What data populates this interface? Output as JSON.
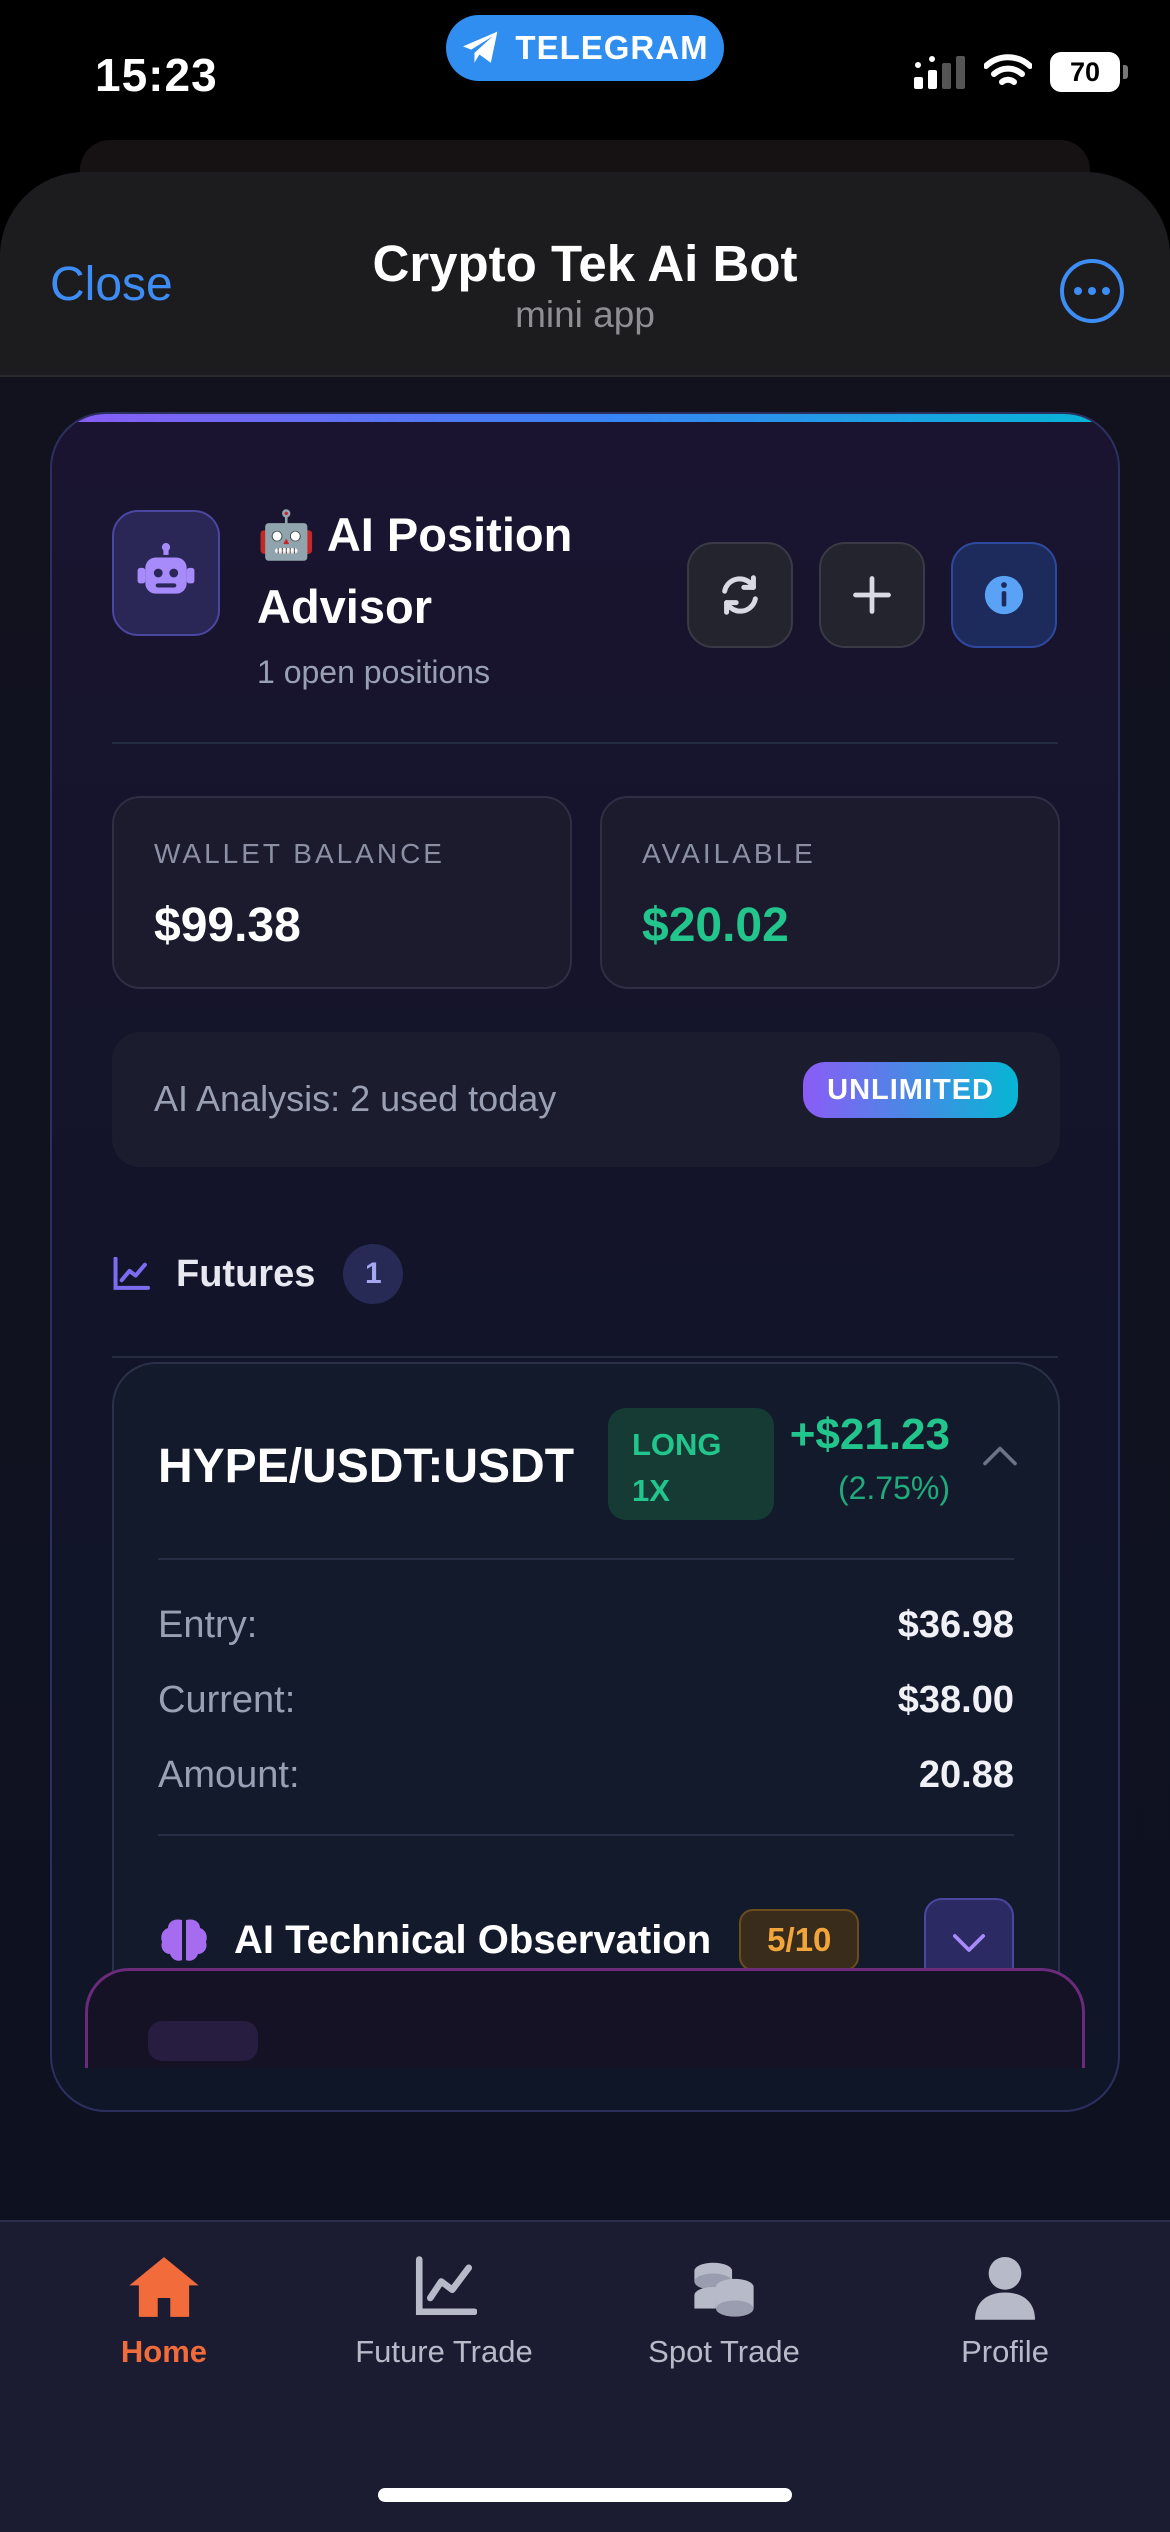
{
  "status_bar": {
    "time": "15:23",
    "app_pill": "TELEGRAM",
    "battery": "70"
  },
  "sheet": {
    "close_label": "Close",
    "title": "Crypto Tek Ai Bot",
    "subtitle": "mini app",
    "accent": "#3d8df5"
  },
  "advisor": {
    "emoji": "🤖",
    "title": "AI Position Advisor",
    "open_positions": "1 open positions",
    "wallet_label": "WALLET BALANCE",
    "wallet_value": "$99.38",
    "available_label": "AVAILABLE",
    "available_value": "$20.02",
    "analysis_text": "AI Analysis: 2 used today",
    "plan_badge": "UNLIMITED"
  },
  "futures": {
    "label": "Futures",
    "count": "1"
  },
  "position": {
    "pair": "HYPE/USDT:USDT",
    "side": "LONG",
    "leverage": "1X",
    "pnl": "+$21.23",
    "pnl_pct": "(2.75%)",
    "rows": [
      {
        "label": "Entry:",
        "value": "$36.98"
      },
      {
        "label": "Current:",
        "value": "$38.00"
      },
      {
        "label": "Amount:",
        "value": "20.88"
      }
    ],
    "ai_label": "AI Technical Observation",
    "ai_score": "5/10"
  },
  "nav": {
    "items": [
      {
        "label": "Home",
        "icon": "home-icon"
      },
      {
        "label": "Future Trade",
        "icon": "chart-line-icon"
      },
      {
        "label": "Spot Trade",
        "icon": "coins-icon"
      },
      {
        "label": "Profile",
        "icon": "user-icon"
      }
    ],
    "active_color": "#f26b3a"
  }
}
